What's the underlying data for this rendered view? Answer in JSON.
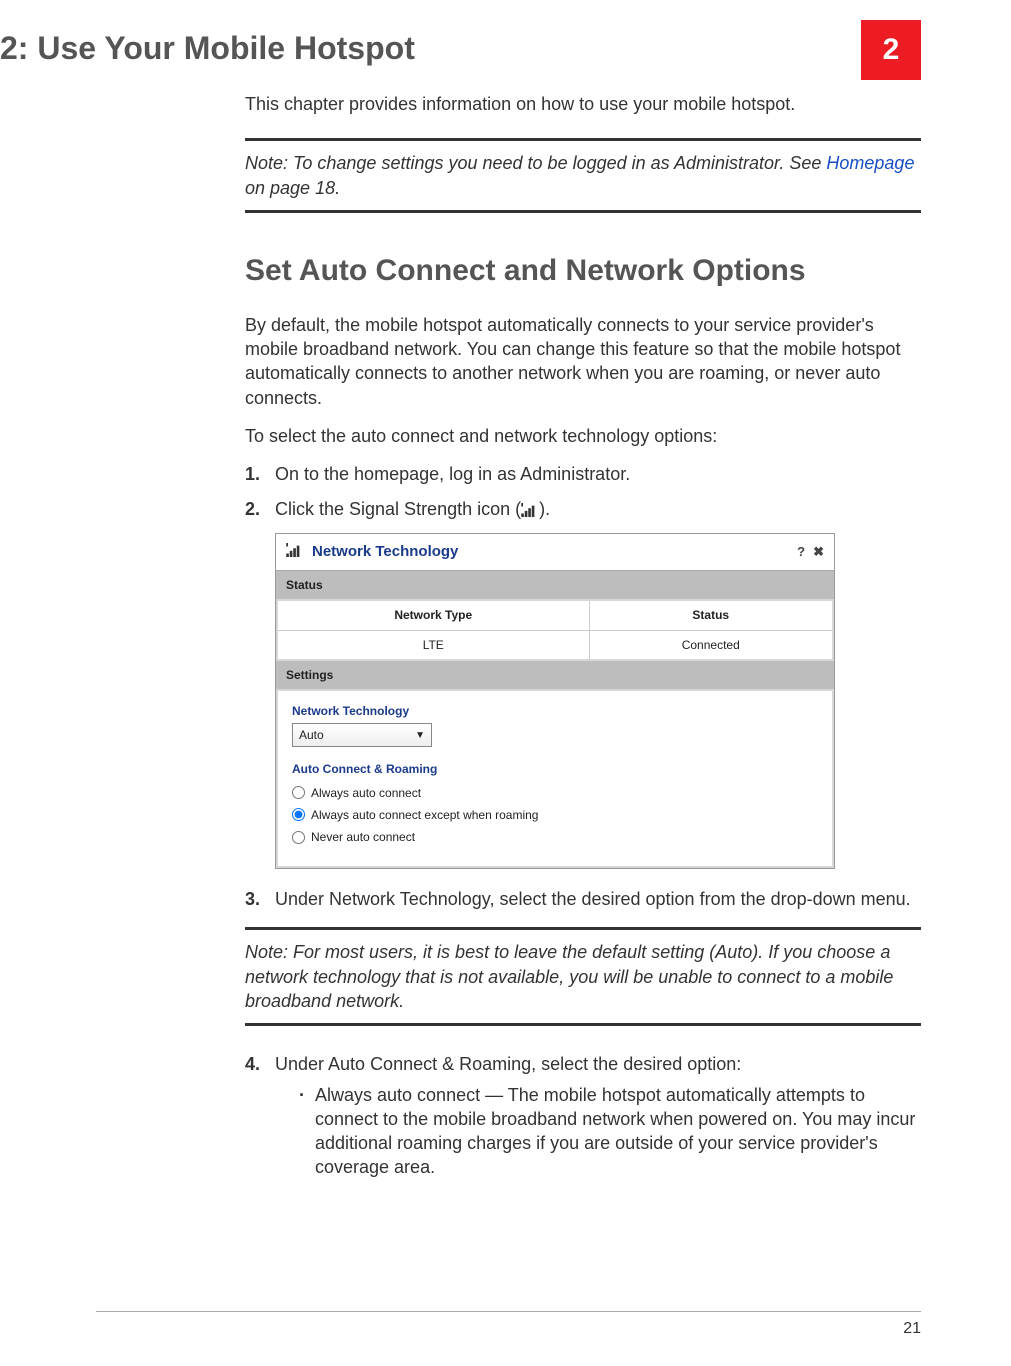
{
  "chapter": {
    "title": "2: Use Your Mobile Hotspot",
    "badge": "2"
  },
  "intro": "This chapter provides information on how to use your mobile hotspot.",
  "note1": {
    "label": "Note:",
    "before_link": " To change settings you need to be logged in as Administrator. See ",
    "link_text": "Homepage",
    "after_link": " on page 18."
  },
  "section": {
    "title": "Set Auto Connect and Network Options",
    "p1": "By default, the mobile hotspot automatically connects to your service provider's mobile broadband network. You can change this feature so that the mobile hotspot automatically connects to another network when you are roaming, or never auto connects.",
    "p2": "To select the auto connect and network technology options:"
  },
  "steps": {
    "s1": "On to the homepage, log in as Administrator.",
    "s2_pre": "Click the Signal Strength icon (",
    "s2_post": ").",
    "s3": "Under Network Technology, select the desired option from the drop-down menu.",
    "s4": "Under Auto Connect & Roaming, select the desired option:",
    "s4_bullet": "Always auto connect — The mobile hotspot automatically attempts to connect to the mobile broadband network when powered on. You may incur additional roaming charges if you are outside of your service provider's coverage area."
  },
  "note2": {
    "label": "Note:",
    "text": " For most users, it is best to leave the default setting (Auto). If you choose a network technology that is not available, you will be unable to connect to a mobile broadband network."
  },
  "panel": {
    "title": "Network Technology",
    "help": "?",
    "close": "✖",
    "status_label": "Status",
    "table": {
      "h1": "Network Type",
      "h2": "Status",
      "c1": "LTE",
      "c2": "Connected"
    },
    "settings_label": "Settings",
    "net_tech_label": "Network Technology",
    "dropdown_value": "Auto",
    "roaming_label": "Auto Connect & Roaming",
    "r1": "Always auto connect",
    "r2": "Always auto connect except when roaming",
    "r3": "Never auto connect"
  },
  "page_number": "21"
}
